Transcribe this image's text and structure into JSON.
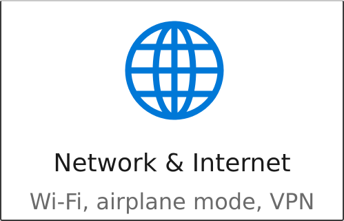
{
  "tile": {
    "title": "Network & Internet",
    "description": "Wi-Fi, airplane mode, VPN",
    "icon": "globe-icon",
    "accent_color": "#0078d7"
  }
}
